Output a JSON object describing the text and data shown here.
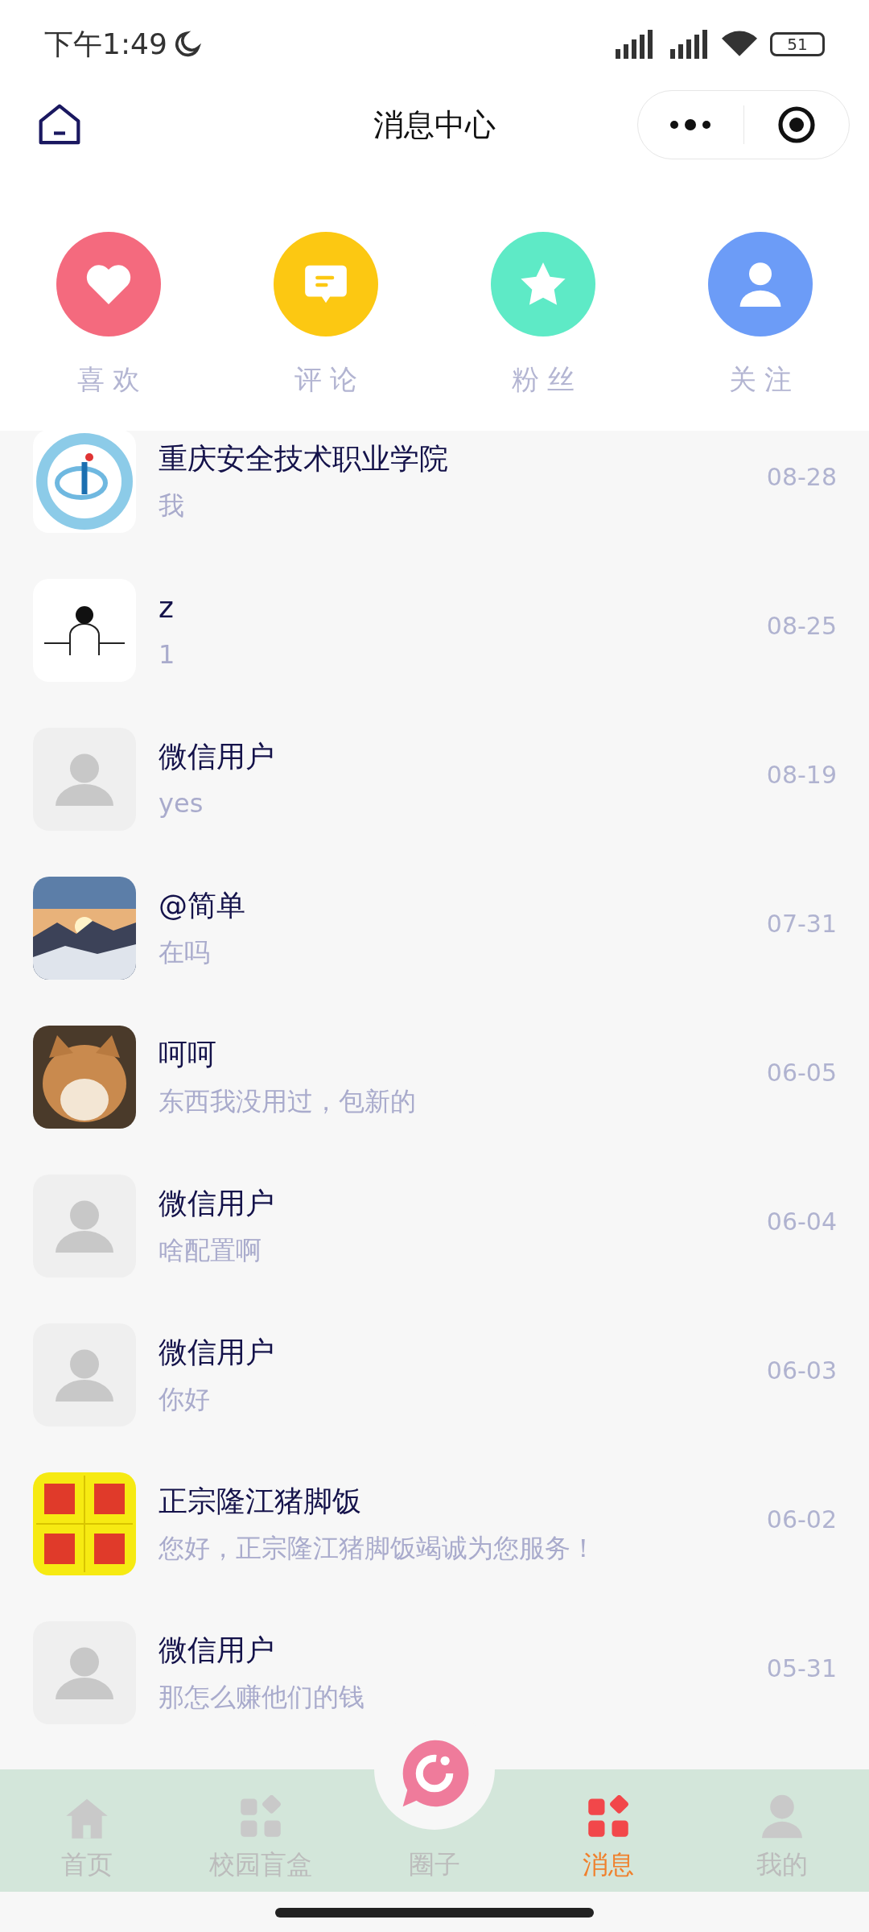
{
  "status_bar": {
    "time": "下午1:49",
    "battery": "51"
  },
  "header": {
    "title": "消息中心"
  },
  "categories": [
    {
      "label": "喜 欢",
      "kind": "heart",
      "color": "#f46a7e"
    },
    {
      "label": "评 论",
      "kind": "comment",
      "color": "#fcc812"
    },
    {
      "label": "粉 丝",
      "kind": "star",
      "color": "#5eeac6"
    },
    {
      "label": "关 注",
      "kind": "person",
      "color": "#6c9cf7"
    }
  ],
  "messages": [
    {
      "name": "重庆安全技术职业学院",
      "message": "我",
      "date": "08-28",
      "avatar": {
        "kind": "emblem"
      }
    },
    {
      "name": "z",
      "message": "1",
      "date": "08-25",
      "avatar": {
        "kind": "sketch"
      }
    },
    {
      "name": "微信用户",
      "message": "yes",
      "date": "08-19",
      "avatar": {
        "kind": "default"
      }
    },
    {
      "name": "@简单",
      "message": "在吗",
      "date": "07-31",
      "avatar": {
        "kind": "sunset"
      }
    },
    {
      "name": "呵呵",
      "message": "东西我没用过，包新的",
      "date": "06-05",
      "avatar": {
        "kind": "pet"
      }
    },
    {
      "name": "微信用户",
      "message": "啥配置啊",
      "date": "06-04",
      "avatar": {
        "kind": "default"
      }
    },
    {
      "name": "微信用户",
      "message": "你好",
      "date": "06-03",
      "avatar": {
        "kind": "default"
      }
    },
    {
      "name": "正宗隆江猪脚饭",
      "message": "您好，正宗隆江猪脚饭竭诚为您服务！",
      "date": "06-02",
      "avatar": {
        "kind": "sign"
      }
    },
    {
      "name": "微信用户",
      "message": "那怎么赚他们的钱",
      "date": "05-31",
      "avatar": {
        "kind": "default"
      }
    }
  ],
  "tab_bar": [
    {
      "label": "首页",
      "kind": "home",
      "selected": false
    },
    {
      "label": "校园盲盒",
      "kind": "grid",
      "selected": false
    },
    {
      "label": "圈子",
      "kind": "circle",
      "selected": false
    },
    {
      "label": "消息",
      "kind": "grid",
      "selected": true
    },
    {
      "label": "我的",
      "kind": "person",
      "selected": false
    }
  ]
}
